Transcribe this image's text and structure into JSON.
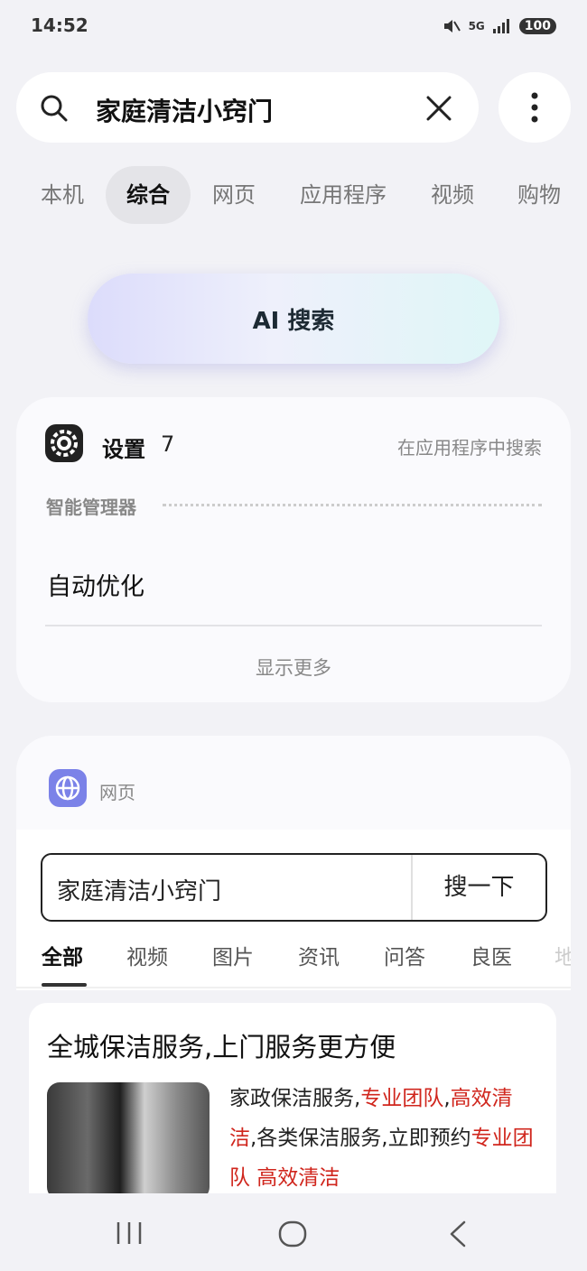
{
  "status_bar": {
    "time": "14:52",
    "network": "5G",
    "battery": "100"
  },
  "search": {
    "query": "家庭清洁小窍门",
    "clear_icon": "close-icon",
    "more_icon": "more-vert-icon"
  },
  "tabs": [
    {
      "label": "本机"
    },
    {
      "label": "综合",
      "active": true
    },
    {
      "label": "网页"
    },
    {
      "label": "应用程序"
    },
    {
      "label": "视频"
    },
    {
      "label": "购物"
    }
  ],
  "ai_search": {
    "label": "AI 搜索"
  },
  "settings_card": {
    "title": "设置",
    "count": "7",
    "action": "在应用程序中搜索",
    "category": "智能管理器",
    "item": "自动优化",
    "show_more": "显示更多"
  },
  "web_card": {
    "label": "网页",
    "search_value": "家庭清洁小窍门",
    "search_button": "搜一下",
    "tabs": [
      "全部",
      "视频",
      "图片",
      "资讯",
      "问答",
      "良医",
      "地"
    ],
    "result": {
      "title": "全城保洁服务,上门服务更方便",
      "desc_parts": [
        {
          "text": "家政保洁服务,"
        },
        {
          "text": "专业团队",
          "red": true
        },
        {
          "text": ","
        },
        {
          "text": "高效清洁",
          "red": true
        },
        {
          "text": ",各类保洁服务,立即预约"
        },
        {
          "text": "专业团队 高效清洁",
          "red": true
        }
      ]
    }
  },
  "colors": {
    "accent_red": "#d0261d",
    "globe_bg": "#7b82e8"
  }
}
